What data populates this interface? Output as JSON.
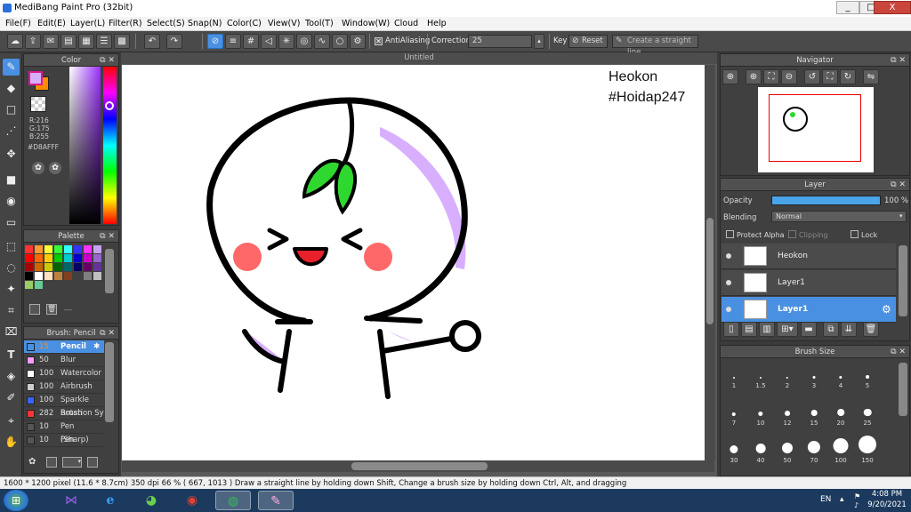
{
  "window": {
    "title": "MediBang Paint Pro (32bit)",
    "min": "_",
    "max": "□",
    "close": "X"
  },
  "menu": [
    "File(F)",
    "Edit(E)",
    "Layer(L)",
    "Filter(R)",
    "Select(S)",
    "Snap(N)",
    "Color(C)",
    "View(V)",
    "Tool(T)",
    "Window(W)",
    "Cloud",
    "Help"
  ],
  "toolbar": {
    "antialiasing_label": "AntiAliasing",
    "correction_label": "Correction",
    "correction_value": "25",
    "key_label": "Key",
    "reset_label": "Reset",
    "straight_line_label": "Create a straight line"
  },
  "color_panel": {
    "title": "Color",
    "r_label": "R:216",
    "g_label": "G:175",
    "b_label": "B:255",
    "hex": "#D8AFFF",
    "primary_color": "#d8afff",
    "secondary_color": "#ff8c00"
  },
  "palette_panel": {
    "title": "Palette",
    "more": "---",
    "swatches": [
      "#ff3333",
      "#ff9933",
      "#ffff33",
      "#33ff33",
      "#33ffff",
      "#3333ff",
      "#ff33ff",
      "#c8a2f0",
      "#ff0000",
      "#ff6600",
      "#ffcc00",
      "#00cc00",
      "#00cccc",
      "#0000cc",
      "#cc00cc",
      "#9966cc",
      "#aa0000",
      "#cc6600",
      "#cccc00",
      "#006600",
      "#006666",
      "#000066",
      "#660066",
      "#663399",
      "#000000",
      "#ffffff",
      "#ffe0c0",
      "#c08040",
      "#804020",
      "#404040",
      "#808080",
      "#c0c0c0",
      "#99cc66",
      "#66cc99"
    ]
  },
  "brush_panel": {
    "title": "Brush: Pencil",
    "brushes": [
      {
        "size": "15",
        "name": "Pencil",
        "color": "#4a90e2"
      },
      {
        "size": "50",
        "name": "Blur",
        "color": "#ff99ff"
      },
      {
        "size": "100",
        "name": "Watercolor",
        "color": "#ffffff"
      },
      {
        "size": "100",
        "name": "Airbrush",
        "color": "#cccccc"
      },
      {
        "size": "100",
        "name": "Sparkle Brush",
        "color": "#3366ff"
      },
      {
        "size": "282",
        "name": "Rotation Sy",
        "color": "#ff3333"
      },
      {
        "size": "10",
        "name": "Pen (Sharp)",
        "color": "#555555"
      },
      {
        "size": "10",
        "name": "Pen",
        "color": "#555555"
      }
    ]
  },
  "canvas": {
    "tab_title": "Untitled",
    "text_line1": "Heokon",
    "text_line2": "#Hoidap247"
  },
  "navigator": {
    "title": "Navigator"
  },
  "layer_panel": {
    "title": "Layer",
    "opacity_label": "Opacity",
    "opacity_value": "100 %",
    "opacity_fraction": 1.0,
    "blending_label": "Blending",
    "blending_value": "Normal",
    "protect_alpha": "Protect Alpha",
    "clipping": "Clipping",
    "lock": "Lock",
    "layers": [
      "Heokon",
      "Layer1",
      "Layer1"
    ]
  },
  "brush_size_panel": {
    "title": "Brush Size",
    "sizes": [
      "1",
      "1.5",
      "2",
      "3",
      "4",
      "5",
      "7",
      "10",
      "12",
      "15",
      "20",
      "25",
      "30",
      "40",
      "50",
      "70",
      "100",
      "150"
    ]
  },
  "status": {
    "text": "1600 * 1200 pixel  (11.6 * 8.7cm)  350 dpi  66 %  ( 667, 1013 )  Draw a straight line by holding down Shift, Change a brush size by holding down Ctrl, Alt, and dragging"
  },
  "taskbar": {
    "lang": "EN",
    "time": "4:08 PM",
    "date": "9/20/2021"
  }
}
